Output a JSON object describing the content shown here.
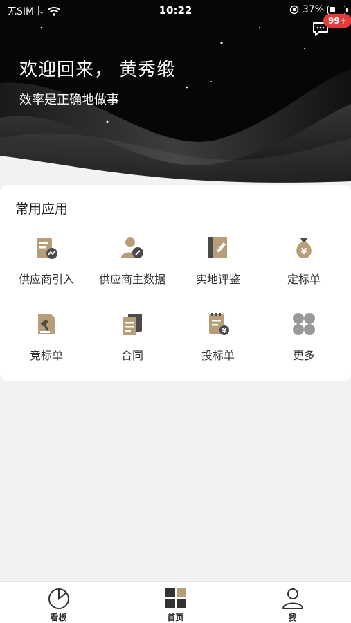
{
  "status_bar": {
    "carrier": "无SIM卡",
    "time": "10:22",
    "battery": "37%"
  },
  "header": {
    "welcome": "欢迎回来， 黄秀缎",
    "motto": "效率是正确地做事",
    "message_badge": "99+"
  },
  "apps": {
    "title": "常用应用",
    "items": [
      {
        "label": "供应商引入",
        "icon": "supplier-intro-icon"
      },
      {
        "label": "供应商主数据",
        "icon": "supplier-master-icon"
      },
      {
        "label": "实地评鉴",
        "icon": "field-review-icon"
      },
      {
        "label": "定标单",
        "icon": "money-bag-icon"
      },
      {
        "label": "竞标单",
        "icon": "gavel-doc-icon"
      },
      {
        "label": "合同",
        "icon": "contract-icon"
      },
      {
        "label": "投标单",
        "icon": "bid-doc-icon"
      },
      {
        "label": "更多",
        "icon": "more-grid-icon"
      }
    ]
  },
  "tabbar": {
    "items": [
      {
        "label": "看板",
        "icon": "pie-chart-icon"
      },
      {
        "label": "首页",
        "icon": "home-grid-icon"
      },
      {
        "label": "我",
        "icon": "profile-icon"
      }
    ]
  },
  "colors": {
    "accent_gold": "#b89e78",
    "accent_dark": "#4a4a4a",
    "badge_red": "#e63b3b"
  }
}
